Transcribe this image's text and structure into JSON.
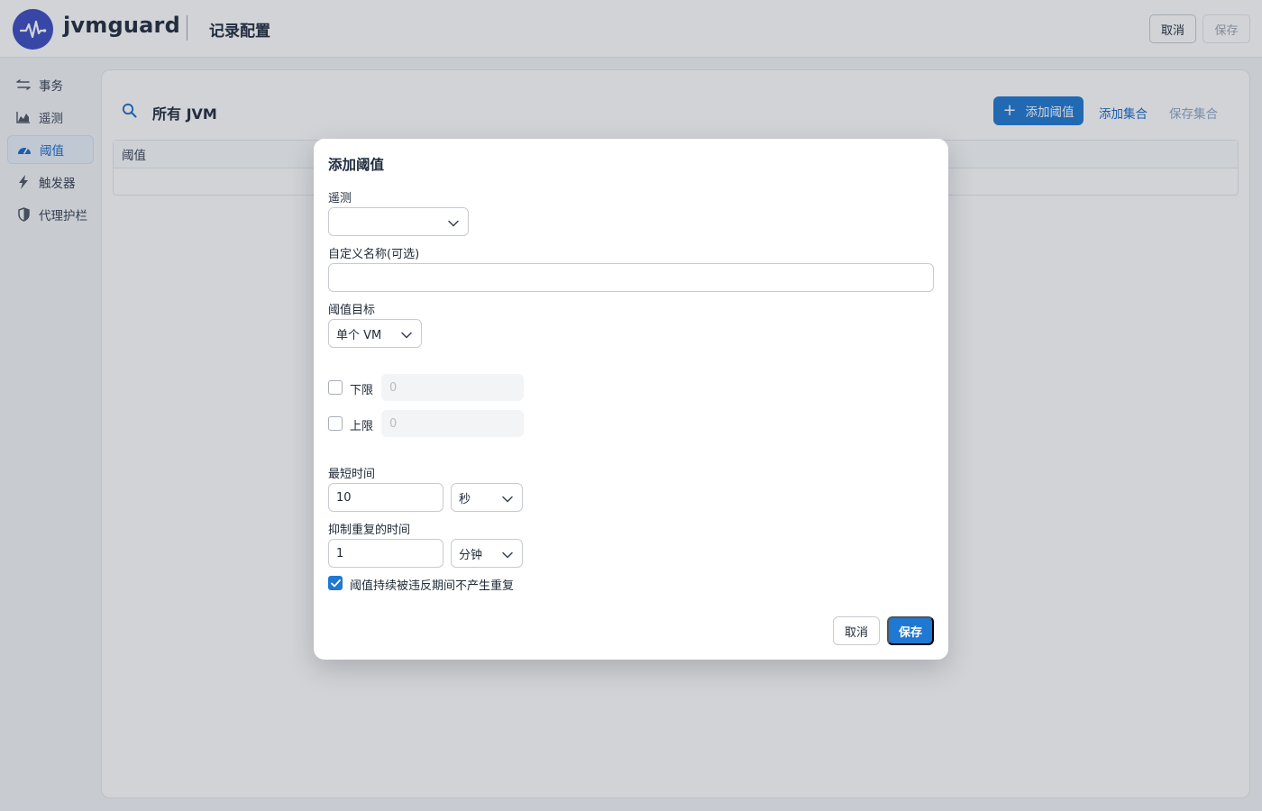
{
  "app": {
    "brand": "jvmguard",
    "page_title": "记录配置",
    "accent_color": "#1f78d1",
    "logo_color": "#3b4cc0"
  },
  "header": {
    "cancel_label": "取消",
    "save_label": "保存"
  },
  "sidebar": {
    "items": [
      {
        "label": "事务",
        "icon": "transactions-icon",
        "active": false
      },
      {
        "label": "遥测",
        "icon": "telemetry-chart-icon",
        "active": false
      },
      {
        "label": "阈值",
        "icon": "gauge-icon",
        "active": true
      },
      {
        "label": "触发器",
        "icon": "lightning-icon",
        "active": false
      },
      {
        "label": "代理护栏",
        "icon": "shield-icon",
        "active": false
      }
    ]
  },
  "main": {
    "title": "所有 JVM",
    "add_threshold_label": "添加阈值",
    "add_set_label": "添加集合",
    "save_set_label": "保存集合",
    "table": {
      "columns": [
        "阈值"
      ]
    }
  },
  "modal": {
    "title": "添加阈值",
    "telemetry": {
      "label": "遥测",
      "value": ""
    },
    "custom_name": {
      "label": "自定义名称(可选)",
      "value": ""
    },
    "threshold_target": {
      "label": "阈值目标",
      "value": "单个 VM"
    },
    "lower_limit": {
      "label": "下限",
      "checked": false,
      "placeholder": "0"
    },
    "upper_limit": {
      "label": "上限",
      "checked": false,
      "placeholder": "0"
    },
    "min_time": {
      "label": "最短时间",
      "value": "10",
      "unit": "秒"
    },
    "suppress_time": {
      "label": "抑制重复的时间",
      "value": "1",
      "unit": "分钟"
    },
    "no_repeat": {
      "label": "阈值持续被违反期间不产生重复",
      "checked": true
    },
    "cancel_label": "取消",
    "save_label": "保存"
  }
}
